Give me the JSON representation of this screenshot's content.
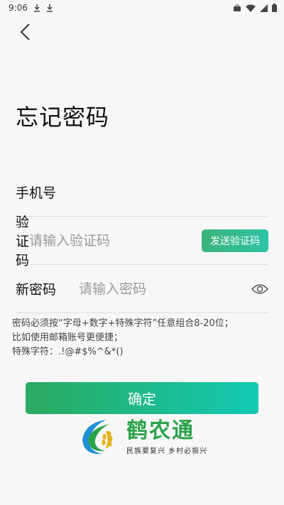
{
  "status_bar": {
    "time": "9:06"
  },
  "page": {
    "title": "忘记密码"
  },
  "form": {
    "phone": {
      "label": "手机号",
      "value": "",
      "placeholder": ""
    },
    "code": {
      "label": "验证码",
      "placeholder": "请输入验证码",
      "send_button": "发送验证码"
    },
    "password": {
      "label": "新密码",
      "placeholder": "请输入密码"
    }
  },
  "hint": {
    "line1": "密码必须按“字母+数字+特殊字符”任意组合8-20位；",
    "line2": "比如使用邮箱账号更便捷；",
    "line3": "特殊字符：.!@#$%^&*()"
  },
  "confirm_button": "确定",
  "brand": {
    "name": "鹤农通",
    "slogan": "民族要复兴 乡村必振兴",
    "color": "#2ba34a"
  },
  "theme": {
    "accent_start": "#2aaa5e",
    "accent_end": "#12c9b5"
  }
}
